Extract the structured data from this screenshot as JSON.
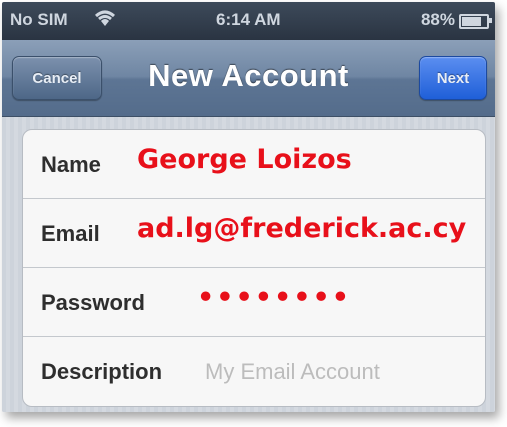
{
  "status_bar": {
    "carrier": "No SIM",
    "time": "6:14 AM",
    "battery": "88%"
  },
  "nav": {
    "title": "New Account",
    "cancel_label": "Cancel",
    "next_label": "Next"
  },
  "form": {
    "name": {
      "label": "Name",
      "value": "George Loizos"
    },
    "email": {
      "label": "Email",
      "value": "ad.lg@frederick.ac.cy"
    },
    "password": {
      "label": "Password",
      "value": "••••••••"
    },
    "description": {
      "label": "Description",
      "placeholder": "My Email Account"
    }
  },
  "colors": {
    "entered_text": "#e8101a",
    "next_button": "#2f6fe0",
    "nav_bar": "#6f86a3"
  },
  "icons": [
    "wifi-icon",
    "battery-icon"
  ],
  "battery_level": 0.88
}
